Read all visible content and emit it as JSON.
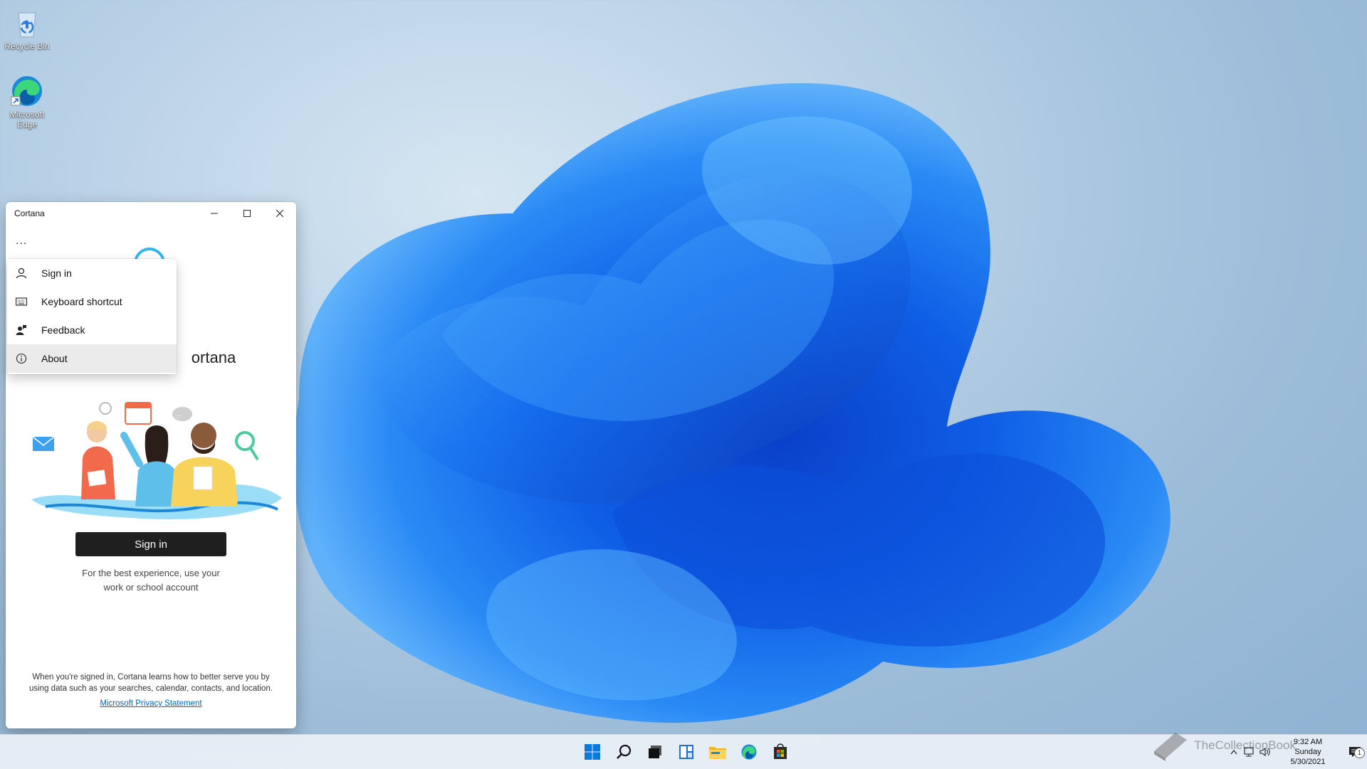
{
  "desktop": {
    "icons": [
      {
        "label": "Recycle Bin",
        "icon": "recycle-bin-icon"
      },
      {
        "label": "Microsoft Edge",
        "icon": "edge-icon"
      }
    ]
  },
  "window": {
    "title": "Cortana",
    "more_label": "...",
    "welcome_text": "ortana",
    "menu": {
      "items": [
        {
          "label": "Sign in",
          "icon": "person-icon"
        },
        {
          "label": "Keyboard shortcut",
          "icon": "keyboard-icon"
        },
        {
          "label": "Feedback",
          "icon": "feedback-icon"
        },
        {
          "label": "About",
          "icon": "info-icon",
          "hovered": true
        }
      ]
    },
    "signin_button": "Sign in",
    "hint_line1": "For the best experience, use your",
    "hint_line2": "work or school account",
    "footer_line1": "When you're signed in, Cortana learns how to better serve you by",
    "footer_line2": "using data such as your searches, calendar, contacts, and location.",
    "privacy_link": "Microsoft Privacy Statement"
  },
  "taskbar": {
    "apps": [
      "start-icon",
      "search-icon",
      "task-view-icon",
      "widgets-icon",
      "file-explorer-icon",
      "edge-icon",
      "store-icon"
    ],
    "clock": {
      "time": "9:32 AM",
      "day": "Sunday",
      "date": "5/30/2021"
    },
    "notification_count": "1"
  },
  "watermark": "TheCollectionBook",
  "colors": {
    "accent": "#0067c0",
    "taskbar": "#e8eef6",
    "cortana_ring": "#33b5f0"
  }
}
